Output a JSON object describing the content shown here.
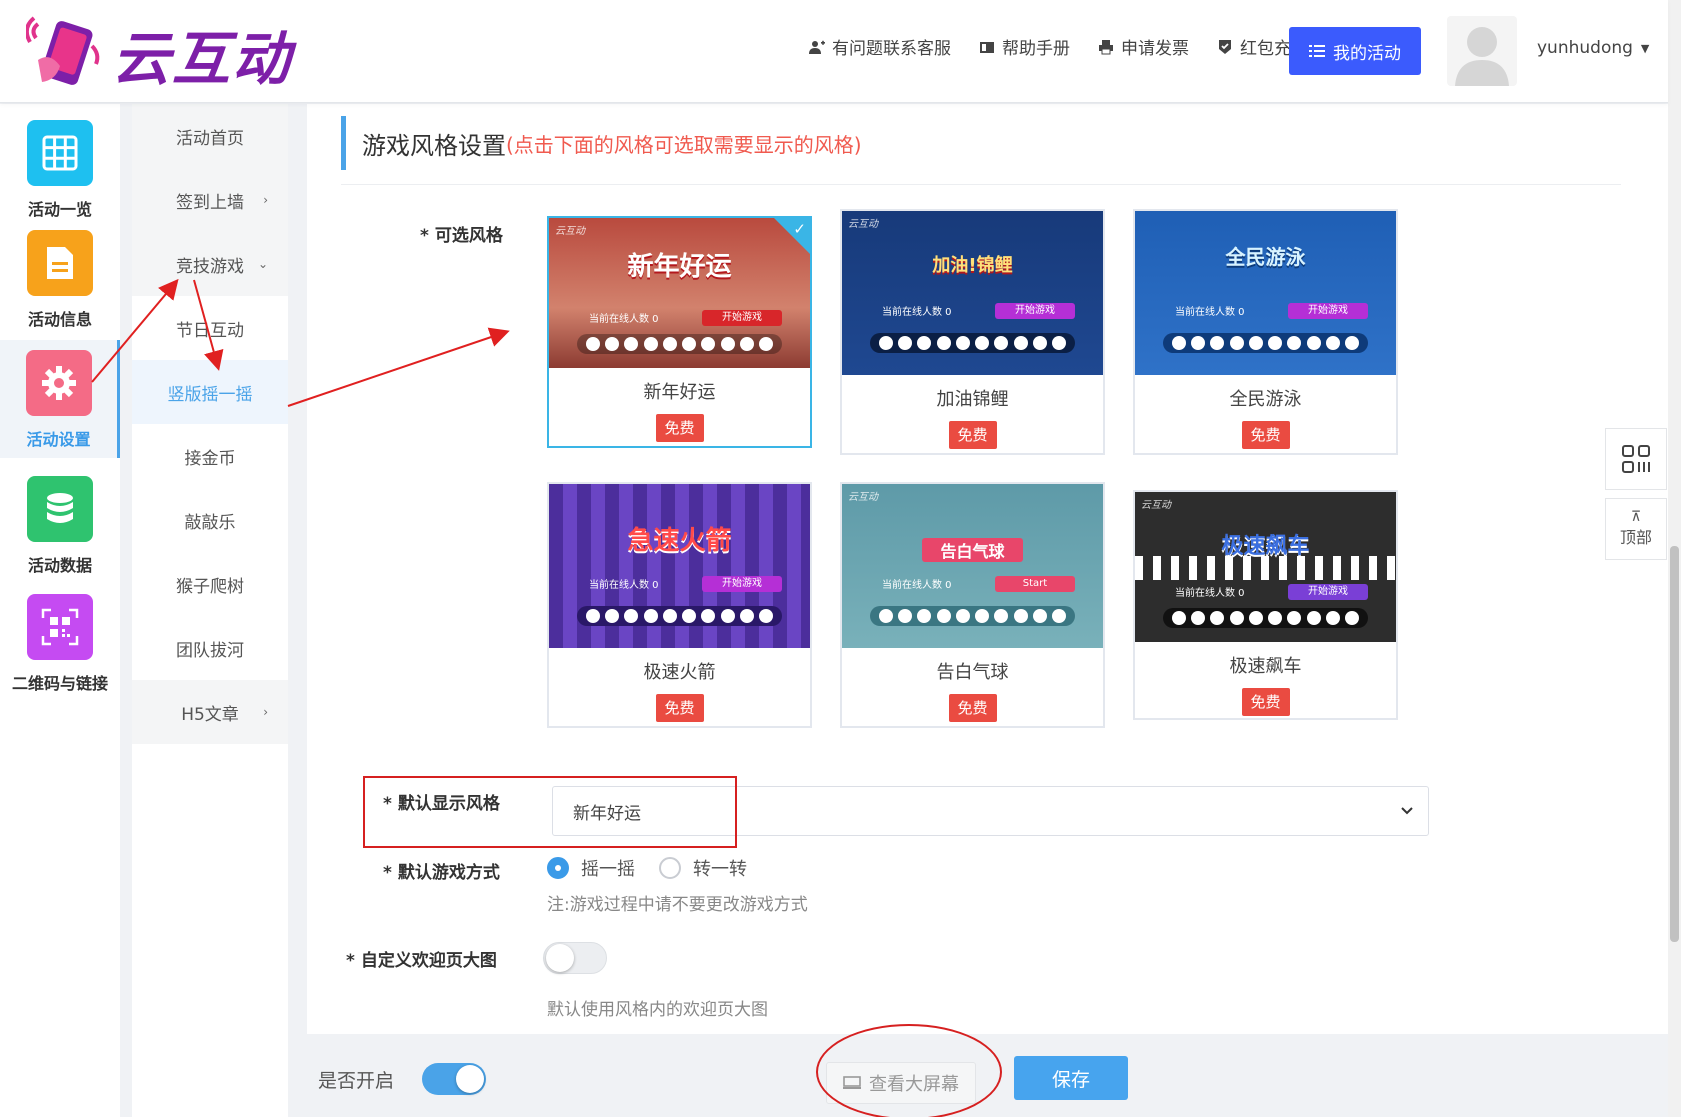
{
  "brand": {
    "name": "云互动"
  },
  "header": {
    "links": [
      {
        "label": "有问题联系客服",
        "icon": "user-plus-icon"
      },
      {
        "label": "帮助手册",
        "icon": "book-icon"
      },
      {
        "label": "申请发票",
        "icon": "printer-icon"
      },
      {
        "label": "红包充值",
        "icon": "shield-check-icon"
      }
    ],
    "my_activity": "我的活动",
    "username": "yunhudong"
  },
  "icon_sidebar": [
    {
      "label": "活动一览",
      "color": "#1ec0f0",
      "icon": "grid-icon"
    },
    {
      "label": "活动信息",
      "color": "#f7a21b",
      "icon": "document-icon"
    },
    {
      "label": "活动设置",
      "color": "#f46b86",
      "icon": "gear-icon",
      "active": true
    },
    {
      "label": "活动数据",
      "color": "#2fc36f",
      "icon": "database-icon"
    },
    {
      "label": "二维码与链接",
      "color": "#c54bf2",
      "icon": "qrcode-icon"
    }
  ],
  "sub_sidebar": [
    {
      "label": "活动首页"
    },
    {
      "label": "签到上墙",
      "chevron": "›"
    },
    {
      "label": "竞技游戏",
      "chevron": "⌄"
    },
    {
      "label": "节日互动"
    },
    {
      "label": "竖版摇一摇",
      "active": true
    },
    {
      "label": "接金币"
    },
    {
      "label": "敲敲乐"
    },
    {
      "label": "猴子爬树"
    },
    {
      "label": "团队拔河"
    },
    {
      "label": "H5文章",
      "chevron": "›"
    }
  ],
  "section": {
    "title": "游戏风格设置",
    "note": "(点击下面的风格可选取需要显示的风格)"
  },
  "styles": {
    "label": "可选风格",
    "badge": "免费",
    "items": [
      {
        "name": "新年好运",
        "thumb_title": "新年好运",
        "bg": "#c76a5c",
        "btn": "开始游戏",
        "selected": true
      },
      {
        "name": "加油锦鲤",
        "thumb_title": "加油!锦鲤",
        "bg": "#1c3c80",
        "btn": "开始游戏"
      },
      {
        "name": "全民游泳",
        "thumb_title": "全民游泳",
        "bg": "#2a64b8",
        "btn": "开始游戏"
      },
      {
        "name": "极速火箭",
        "thumb_title": "急速火箭",
        "bg": "#5a3cab",
        "btn": "开始游戏"
      },
      {
        "name": "告白气球",
        "thumb_title": "告白气球",
        "bg": "#6aa3ad",
        "btn": "Start"
      },
      {
        "name": "极速飙车",
        "thumb_title": "极速飙车",
        "bg": "#2d2d2d",
        "btn": "开始游戏"
      }
    ],
    "thumb_brand": "云互动",
    "thumb_online": "当前在线人数 0"
  },
  "default_style": {
    "label": "默认显示风格",
    "value": "新年好运"
  },
  "game_mode": {
    "label": "默认游戏方式",
    "options": [
      "摇一摇",
      "转一转"
    ],
    "selected": "摇一摇",
    "note": "注:游戏过程中请不要更改游戏方式"
  },
  "custom_welcome": {
    "label": "自定义欢迎页大图",
    "enabled": false,
    "note": "默认使用风格内的欢迎页大图"
  },
  "bottom": {
    "enable_label": "是否开启",
    "enabled": true,
    "preview": "查看大屏幕",
    "save": "保存"
  },
  "float_tools": {
    "top_label": "顶部"
  }
}
